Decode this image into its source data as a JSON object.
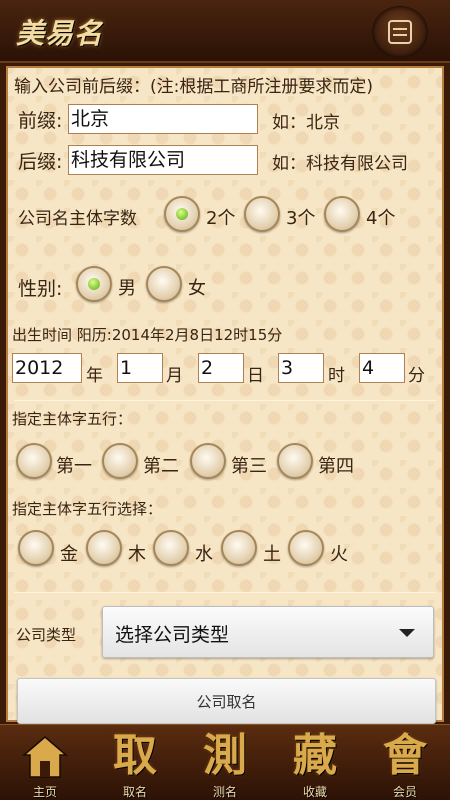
{
  "app": {
    "title": "美易名",
    "colors": {
      "header_bg": "#3b1a08",
      "panel_bg": "#f7e6c6",
      "radio_selected": "#5aa810",
      "tab_glyph": "#d9a94c"
    }
  },
  "header": {
    "menu_icon": "menu-list-icon"
  },
  "form": {
    "intro": "输入公司前后缀：(注:根据工商所注册要求而定)",
    "prefix": {
      "label": "前缀:",
      "value": "北京",
      "example": "如：北京"
    },
    "suffix": {
      "label": "后缀:",
      "value": "科技有限公司",
      "example": "如：科技有限公司"
    },
    "char_count": {
      "label": "公司名主体字数",
      "options": [
        "2个",
        "3个",
        "4个"
      ],
      "selected": "2个"
    },
    "gender": {
      "label": "性别:",
      "options": [
        "男",
        "女"
      ],
      "selected": "男"
    },
    "birth": {
      "label": "出生时间 阳历:2014年2月8日12时15分",
      "year": "2012",
      "year_unit": "年",
      "month": "1",
      "month_unit": "月",
      "day": "2",
      "day_unit": "日",
      "hour": "3",
      "hour_unit": "时",
      "minute": "4",
      "minute_unit": "分"
    },
    "wuxing_position": {
      "label": "指定主体字五行：",
      "options": [
        "第一",
        "第二",
        "第三",
        "第四"
      ]
    },
    "wuxing_element": {
      "label": "指定主体字五行选择：",
      "options": [
        "金",
        "木",
        "水",
        "土",
        "火"
      ]
    },
    "company_type": {
      "label": "公司类型",
      "value": "选择公司类型"
    },
    "submit_label": "公司取名"
  },
  "tabbar": {
    "tabs": [
      {
        "glyph": "",
        "label": "主页",
        "icon": "home-icon"
      },
      {
        "glyph": "取",
        "label": "取名"
      },
      {
        "glyph": "測",
        "label": "测名"
      },
      {
        "glyph": "藏",
        "label": "收藏"
      },
      {
        "glyph": "會",
        "label": "会员"
      }
    ]
  }
}
